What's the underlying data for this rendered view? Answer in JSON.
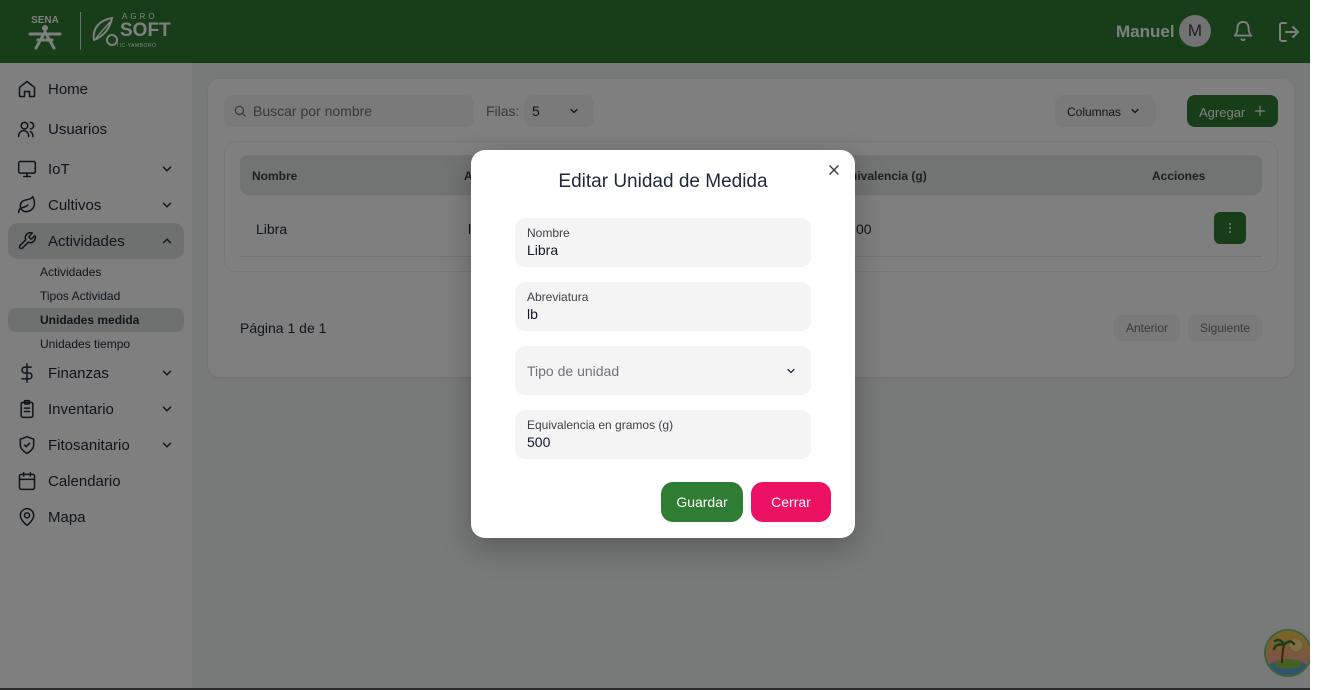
{
  "header": {
    "logo_left_text": "SENA",
    "logo_right": {
      "top": "AGRO",
      "main": "SOFT",
      "bottom": "TIC-YAMBORÓ"
    },
    "user_name": "Manuel",
    "avatar_letter": "M"
  },
  "sidebar": {
    "items": [
      {
        "label": "Home",
        "icon": "home-icon"
      },
      {
        "label": "Usuarios",
        "icon": "users-icon"
      },
      {
        "label": "IoT",
        "icon": "monitor-icon",
        "expandable": true
      },
      {
        "label": "Cultivos",
        "icon": "leaf-icon",
        "expandable": true
      },
      {
        "label": "Actividades",
        "icon": "wrench-icon",
        "expandable": true,
        "expanded": true,
        "active": true
      },
      {
        "label": "Finanzas",
        "icon": "dollar-icon",
        "expandable": true
      },
      {
        "label": "Inventario",
        "icon": "clipboard-icon",
        "expandable": true
      },
      {
        "label": "Fitosanitario",
        "icon": "shield-icon",
        "expandable": true
      },
      {
        "label": "Calendario",
        "icon": "calendar-icon"
      },
      {
        "label": "Mapa",
        "icon": "map-pin-icon"
      }
    ],
    "sub_items": [
      {
        "label": "Actividades"
      },
      {
        "label": "Tipos Actividad"
      },
      {
        "label": "Unidades medida",
        "active": true
      },
      {
        "label": "Unidades tiempo"
      }
    ]
  },
  "toolbar": {
    "search_placeholder": "Buscar por nombre",
    "rows_label": "Filas:",
    "rows_value": "5",
    "columns_label": "Columnas",
    "add_label": "Agregar"
  },
  "table": {
    "headers": [
      "Nombre",
      "A",
      "uivalencia (g)",
      "Acciones"
    ],
    "rows": [
      {
        "nombre": "Libra",
        "abreviatura": "l",
        "equivalencia": "00"
      }
    ]
  },
  "pagination": {
    "info": "Página 1 de 1",
    "prev_label": "Anterior",
    "next_label": "Siguiente"
  },
  "modal": {
    "title": "Editar Unidad de Medida",
    "fields": {
      "nombre": {
        "label": "Nombre",
        "value": "Libra"
      },
      "abreviatura": {
        "label": "Abreviatura",
        "value": "lb"
      },
      "tipo": {
        "placeholder": "Tipo de unidad"
      },
      "equivalencia": {
        "label": "Equivalencia en gramos (g)",
        "value": "500"
      }
    },
    "save_label": "Guardar",
    "close_label": "Cerrar"
  },
  "colors": {
    "brand_green": "#2e7d32",
    "danger_pink": "#ec1163"
  }
}
